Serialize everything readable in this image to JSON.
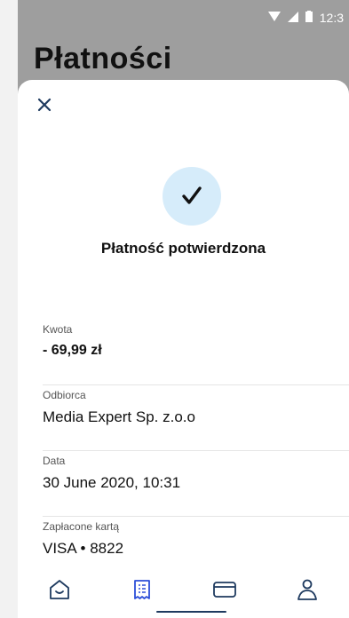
{
  "status_bar": {
    "time": "12:3"
  },
  "page": {
    "title": "Płatności"
  },
  "sheet": {
    "confirm_text": "Płatność potwierdzona",
    "details": [
      {
        "label": "Kwota",
        "value": "- 69,99 zł",
        "bold": true
      },
      {
        "label": "Odbiorca",
        "value": "Media Expert Sp. z.o.o"
      },
      {
        "label": "Data",
        "value": "30 June 2020, 10:31"
      },
      {
        "label": "Zapłacone kartą",
        "value": "VISA • 8822"
      }
    ]
  },
  "nav": {
    "items": [
      {
        "icon": "home-icon"
      },
      {
        "icon": "receipt-icon",
        "active": true
      },
      {
        "icon": "card-icon"
      },
      {
        "icon": "profile-icon"
      }
    ]
  },
  "colors": {
    "accent": "#1e3a5f",
    "active_icon": "#2c4fd8",
    "check_bg": "#d6ecfa",
    "header_bg": "#9e9e9e"
  }
}
